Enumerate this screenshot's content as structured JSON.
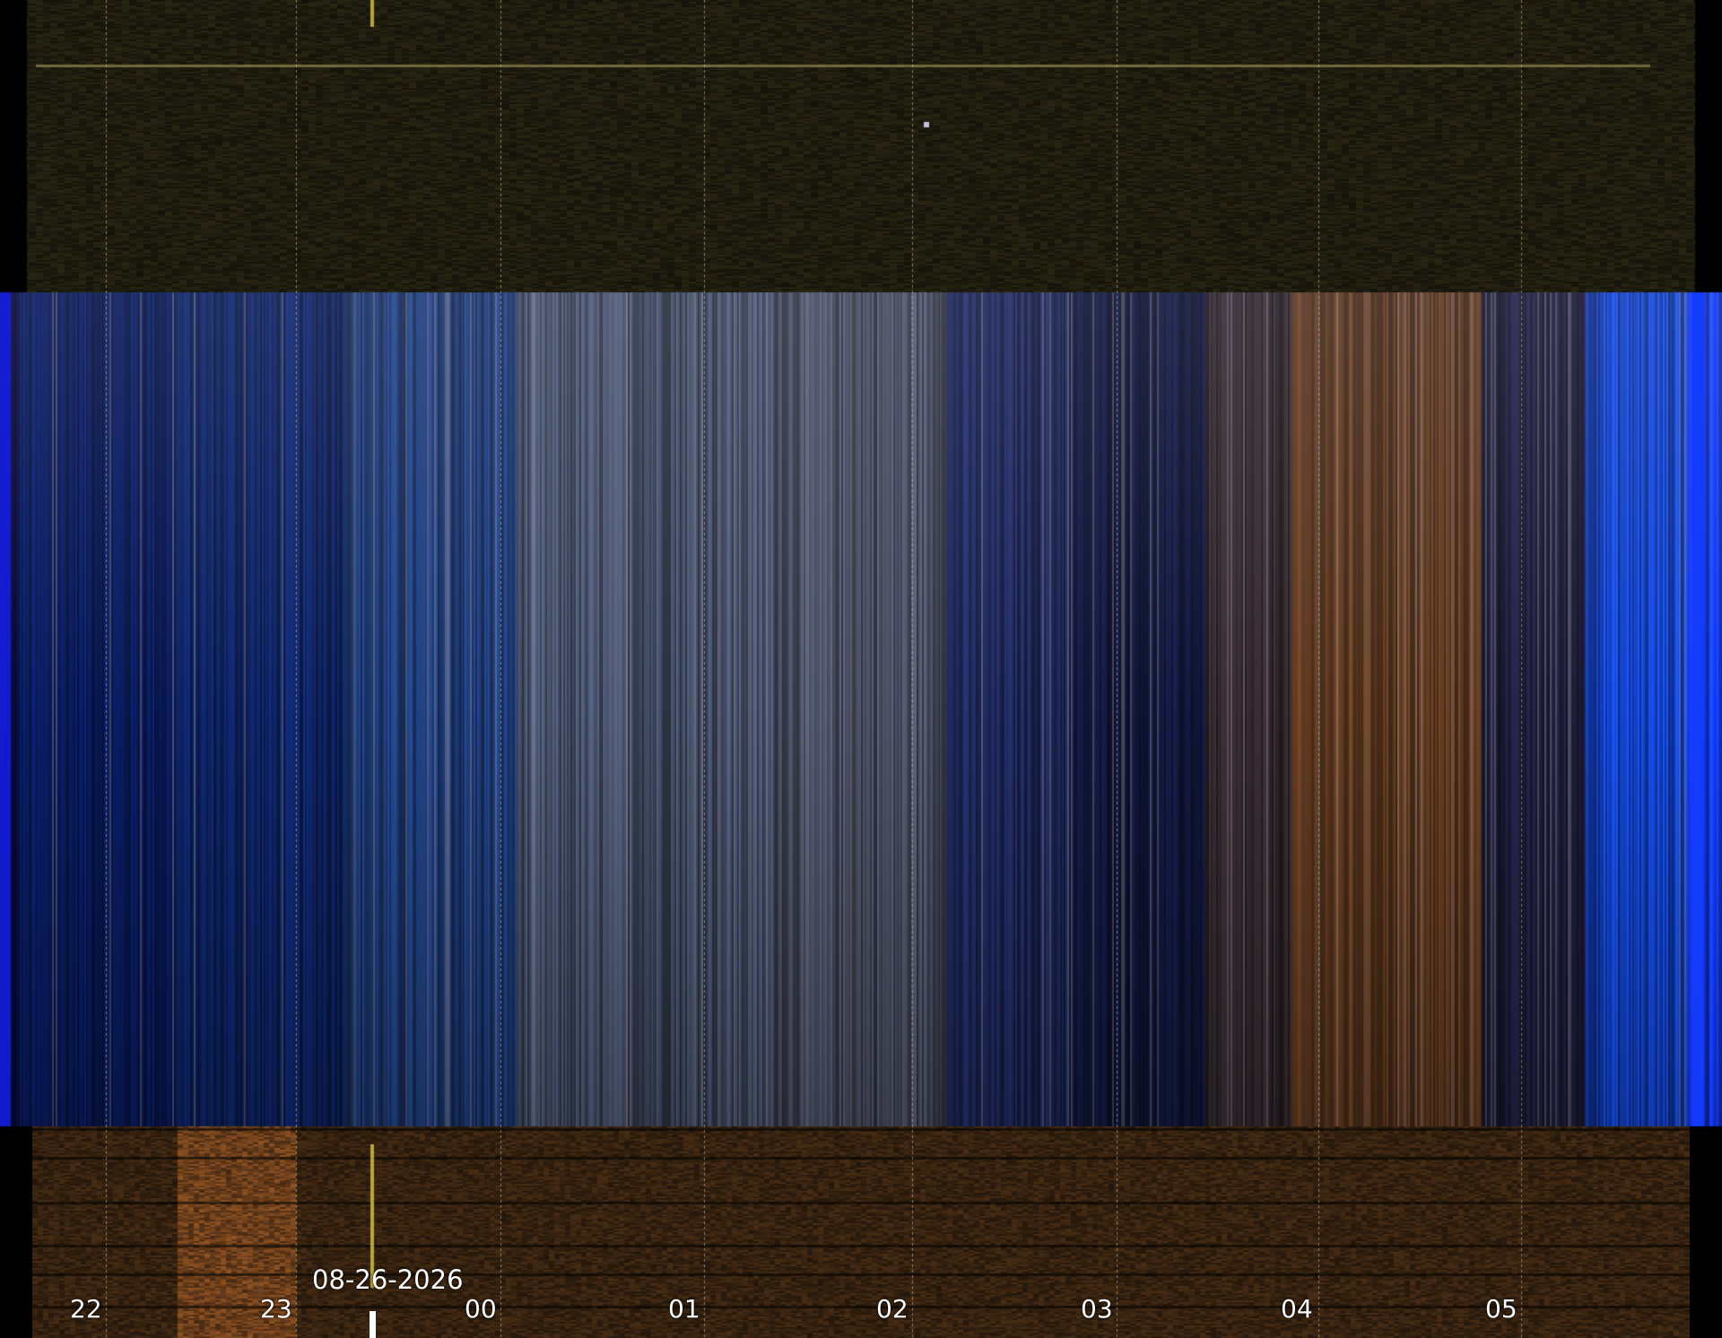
{
  "image": {
    "kind": "keogram",
    "date_label": "08-26-2026",
    "hour_labels": [
      "22",
      "23",
      "00",
      "01",
      "02",
      "03",
      "04",
      "05"
    ],
    "colors": {
      "sky_blue": "#0a2a8a",
      "twilight_edge_blue": "#1440ff",
      "dawn_brown": "#6a3e1e",
      "top_band": "#1c1a0c",
      "bottom_band": "#3a2410",
      "grid_line": "#d8cfae",
      "label": "#ffffff"
    }
  }
}
